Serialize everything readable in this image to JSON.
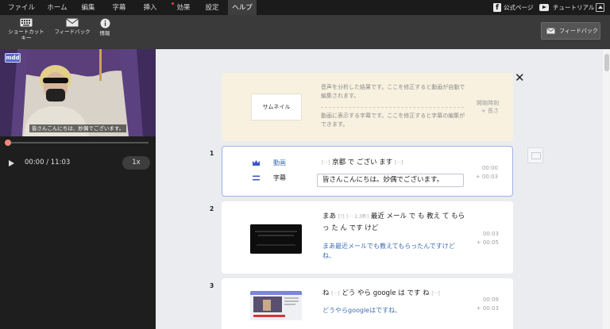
{
  "menu": {
    "items": [
      "ファイル",
      "ホーム",
      "編集",
      "字幕",
      "挿入",
      "効果",
      "設定",
      "ヘルプ"
    ],
    "active": "ヘルプ",
    "links": {
      "official_page": "公式ページ",
      "tutorial": "チュートリアル"
    }
  },
  "toolbar": {
    "shortcut_label": "ショートカットキー",
    "feedback_label": "フィードバック",
    "info_label": "情報",
    "feedback_button": "フィードバック"
  },
  "player": {
    "logo": "mdd",
    "caption": "皆さんこんにちは、妙偶でございます。",
    "time": "00:00 / 11:03",
    "speed": "1x",
    "progress": 0.0
  },
  "hint": {
    "thumbnail_label": "サムネイル",
    "line1": "音声を分析した結果です。ここを修正すると動画が自動で編集されます。",
    "line2": "動画に表示する字幕です。ここを修正すると字幕の編集ができます。",
    "side_line1": "開始時刻",
    "side_line2": "+ 長さ"
  },
  "segments": [
    {
      "num": "1",
      "video_label": "動画",
      "subtitle_label": "字幕",
      "words_pre": "[···]",
      "words": "京都 で ござい ます",
      "words_post": "[···]",
      "subtitle": "皆さんこんにちは。妙偶でございます。",
      "start": "00:00",
      "duration": "+ 00:03"
    },
    {
      "num": "2",
      "words_a": "まあ",
      "tag_a": "[?]",
      "tag_b": "[··· 2.3秒]",
      "words_b": "最近 メール で も 教え て もらっ た ん です けど",
      "subtitle": "まあ最近メールでも教えてもらったんですけどね、",
      "start": "00:03",
      "duration": "+ 00:05"
    },
    {
      "num": "3",
      "words_a": "ね",
      "tag_a": "[···]",
      "words_b": "どう やら google は です ね",
      "tag_b": "[···]",
      "subtitle": "どうやらgoogleはですね、",
      "start": "00:09",
      "duration": "+ 00:03"
    }
  ]
}
